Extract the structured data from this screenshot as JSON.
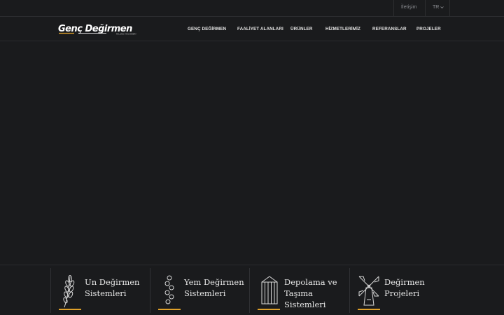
{
  "topbar": {
    "contact_label": "İletişim",
    "language_label": "TR"
  },
  "header": {
    "logo_text": "Genç Değirmen",
    "logo_subtext": "MILLING MACHINERY",
    "nav": [
      {
        "label": "GENÇ DEĞİRMEN"
      },
      {
        "label": "FAALİYET ALANLARI"
      },
      {
        "label": "ÜRÜNLER"
      },
      {
        "label": "HİZMETLERİMİZ"
      },
      {
        "label": "REFERANSLAR"
      },
      {
        "label": "PROJELER"
      }
    ]
  },
  "features": [
    {
      "line1": "Un Değirmen",
      "line2": "Sistemleri",
      "icon": "wheat-icon"
    },
    {
      "line1": "Yem Değirmen",
      "line2": "Sistemleri",
      "icon": "pellets-icon"
    },
    {
      "line1": "Depolama ve",
      "line2": "Taşıma Sistemleri",
      "icon": "silo-icon"
    },
    {
      "line1": "Değirmen Projeleri",
      "line2": "",
      "icon": "windmill-icon"
    }
  ],
  "colors": {
    "background": "#1a1b1d",
    "accent": "#e0a12a",
    "nav_text": "#e6e6e6",
    "muted_text": "#8e9095"
  }
}
